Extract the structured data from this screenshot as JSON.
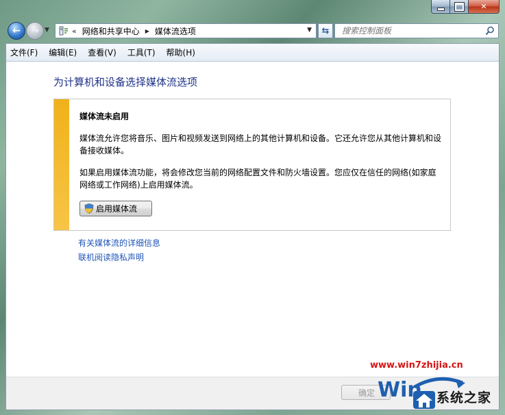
{
  "window": {
    "caption_buttons": {
      "minimize": "minimize",
      "maximize": "maximize",
      "close": "close"
    }
  },
  "nav": {
    "back_icon": "back-arrow-icon",
    "forward_icon": "forward-arrow-icon",
    "address": {
      "overflow": "«",
      "crumbs": [
        "网络和共享中心",
        "媒体流选项"
      ],
      "separator": "▶"
    },
    "search": {
      "placeholder": "搜索控制面板"
    }
  },
  "menu": [
    "文件(F)",
    "编辑(E)",
    "查看(V)",
    "工具(T)",
    "帮助(H)"
  ],
  "main": {
    "heading": "为计算机和设备选择媒体流选项",
    "panel": {
      "accent_color": "#F2B31E",
      "title": "媒体流未启用",
      "paragraph1": "媒体流允许您将音乐、图片和视频发送到网络上的其他计算机和设备。它还允许您从其他计算机和设备接收媒体。",
      "paragraph2": "如果启用媒体流功能，将会修改您当前的网络配置文件和防火墙设置。您应仅在信任的网络(如家庭网络或工作网络)上启用媒体流。",
      "enable_button": "启用媒体流"
    },
    "links": [
      "有关媒体流的详细信息",
      "联机阅读隐私声明"
    ]
  },
  "footer": {
    "ok_button": "确定"
  },
  "watermark": {
    "url": "www.win7zhijia.cn",
    "site_name": "系统之家"
  },
  "colors": {
    "link": "#1F54B8",
    "heading": "#1E3287",
    "watermark_url": "#D41414"
  }
}
